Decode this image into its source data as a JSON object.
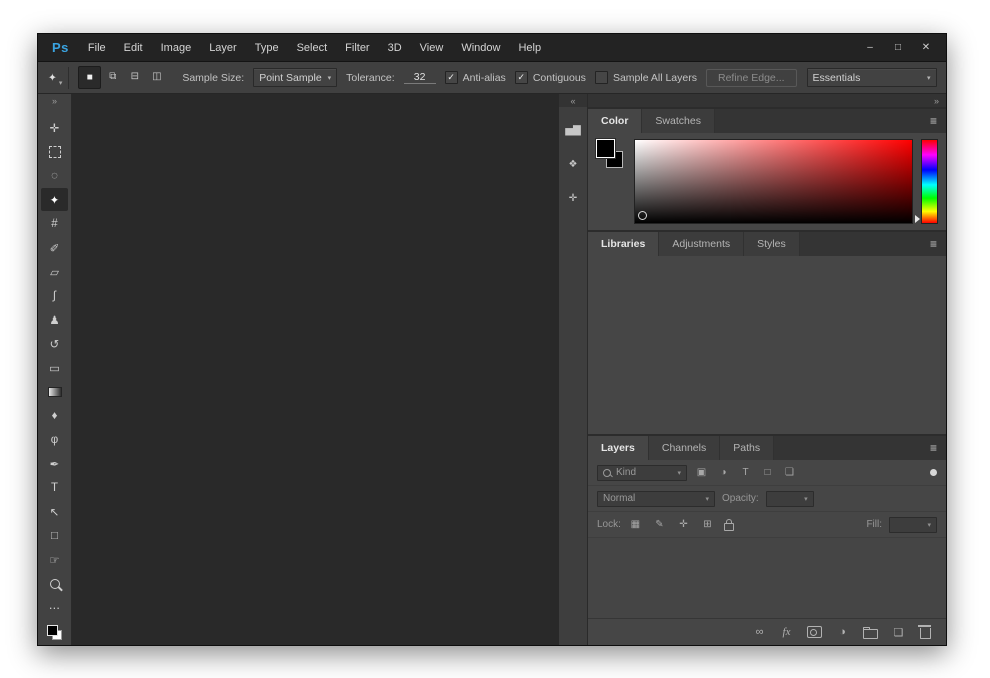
{
  "titlebar": {
    "logo": "Ps",
    "menus": [
      "File",
      "Edit",
      "Image",
      "Layer",
      "Type",
      "Select",
      "Filter",
      "3D",
      "View",
      "Window",
      "Help"
    ],
    "controls": {
      "minimize": "–",
      "maximize": "□",
      "close": "✕"
    }
  },
  "options_bar": {
    "tool_icon_glyph": "✦",
    "tool_chevron": "▾",
    "selection_modes": [
      {
        "name": "new-selection",
        "glyph": "■",
        "selected": true
      },
      {
        "name": "add-to-selection",
        "glyph": "⧉",
        "selected": false
      },
      {
        "name": "subtract-from-selection",
        "glyph": "⊟",
        "selected": false
      },
      {
        "name": "intersect-with-selection",
        "glyph": "◫",
        "selected": false
      }
    ],
    "sample_size_label": "Sample Size:",
    "sample_size_value": "Point Sample",
    "tolerance_label": "Tolerance:",
    "tolerance_value": "32",
    "checkboxes": [
      {
        "label": "Anti-alias",
        "checked": true
      },
      {
        "label": "Contiguous",
        "checked": true
      },
      {
        "label": "Sample All Layers",
        "checked": false
      }
    ],
    "refine_edge_label": "Refine Edge...",
    "workspace_value": "Essentials",
    "chevron": "▾"
  },
  "toolbar": {
    "collapse_glyph": "»",
    "tools": [
      {
        "name": "move-tool",
        "glyph": "✛",
        "selected": false
      },
      {
        "name": "rectangular-marquee-tool",
        "glyph": "",
        "selected": false
      },
      {
        "name": "lasso-tool",
        "glyph": "◌",
        "selected": false
      },
      {
        "name": "magic-wand-tool",
        "glyph": "✦",
        "selected": true
      },
      {
        "name": "crop-tool",
        "glyph": "#",
        "selected": false
      },
      {
        "name": "eyedropper-tool",
        "glyph": "✐",
        "selected": false
      },
      {
        "name": "spot-healing-brush-tool",
        "glyph": "▱",
        "selected": false
      },
      {
        "name": "brush-tool",
        "glyph": "∫",
        "selected": false
      },
      {
        "name": "clone-stamp-tool",
        "glyph": "♟",
        "selected": false
      },
      {
        "name": "history-brush-tool",
        "glyph": "↺",
        "selected": false
      },
      {
        "name": "eraser-tool",
        "glyph": "▭",
        "selected": false
      },
      {
        "name": "gradient-tool",
        "glyph": "",
        "selected": false
      },
      {
        "name": "blur-tool",
        "glyph": "♦",
        "selected": false
      },
      {
        "name": "dodge-tool",
        "glyph": "φ",
        "selected": false
      },
      {
        "name": "pen-tool",
        "glyph": "✒",
        "selected": false
      },
      {
        "name": "type-tool",
        "glyph": "T",
        "selected": false
      },
      {
        "name": "path-selection-tool",
        "glyph": "↖",
        "selected": false
      },
      {
        "name": "rectangle-tool",
        "glyph": "□",
        "selected": false
      },
      {
        "name": "hand-tool",
        "glyph": "☞",
        "selected": false
      },
      {
        "name": "zoom-tool",
        "glyph": "",
        "selected": false
      },
      {
        "name": "edit-toolbar",
        "glyph": "⋯",
        "selected": false
      }
    ]
  },
  "dock": {
    "collapse_glyph": "«",
    "icons": [
      {
        "name": "histogram-panel-icon",
        "glyph": "▅▇"
      },
      {
        "name": "properties-panel-icon",
        "glyph": "❖"
      },
      {
        "name": "info-panel-icon",
        "glyph": "✛"
      }
    ]
  },
  "panels": {
    "collapse_glyph": "»",
    "menu_glyph": "≡",
    "color": {
      "tabs": [
        "Color",
        "Swatches"
      ],
      "active_tab": "Color"
    },
    "libraries": {
      "tabs": [
        "Libraries",
        "Adjustments",
        "Styles"
      ],
      "active_tab": "Libraries"
    },
    "layers": {
      "tabs": [
        "Layers",
        "Channels",
        "Paths"
      ],
      "active_tab": "Layers",
      "filter_label": "Kind",
      "filter_icons": [
        {
          "name": "pixel-layer-filter-icon",
          "glyph": "▣"
        },
        {
          "name": "adjustment-layer-filter-icon",
          "glyph": "◑"
        },
        {
          "name": "type-layer-filter-icon",
          "glyph": "T"
        },
        {
          "name": "shape-layer-filter-icon",
          "glyph": "□"
        },
        {
          "name": "smart-object-filter-icon",
          "glyph": "❏"
        }
      ],
      "blend_mode_value": "Normal",
      "opacity_label": "Opacity:",
      "lock_label": "Lock:",
      "lock_icons": [
        {
          "name": "lock-transparent-pixels-icon",
          "glyph": "▦"
        },
        {
          "name": "lock-image-pixels-icon",
          "glyph": "✎"
        },
        {
          "name": "lock-position-icon",
          "glyph": "✛"
        },
        {
          "name": "lock-artboard-icon",
          "glyph": "⊞"
        }
      ],
      "fill_label": "Fill:",
      "bottom_icons": [
        {
          "name": "link-layers-icon",
          "glyph": "∞"
        },
        {
          "name": "layer-effects-icon",
          "glyph": "fx"
        },
        {
          "name": "layer-mask-icon",
          "glyph": ""
        },
        {
          "name": "adjustment-layer-icon",
          "glyph": "◑"
        },
        {
          "name": "layer-group-icon",
          "glyph": ""
        },
        {
          "name": "new-layer-icon",
          "glyph": "❏"
        },
        {
          "name": "delete-layer-icon",
          "glyph": ""
        }
      ]
    }
  },
  "colors": {
    "accent_blue": "#3aa3e0",
    "titlebar_bg": "#232323",
    "options_bg": "#404040",
    "panel_bg": "#464646",
    "canvas_bg": "#292929",
    "hue_ramp": [
      "#ff0000",
      "#ff00ff",
      "#0000ff",
      "#00ffff",
      "#00ff00",
      "#ffff00",
      "#ff0000"
    ]
  }
}
